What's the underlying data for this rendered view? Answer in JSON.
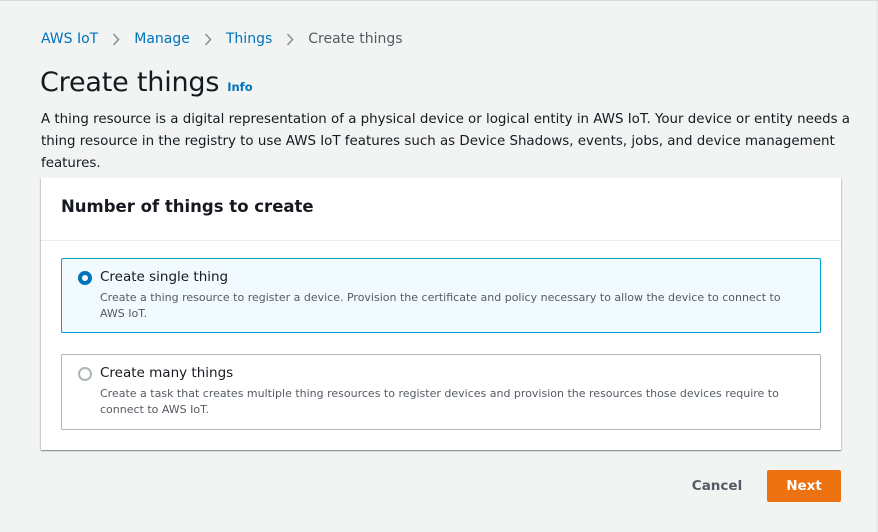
{
  "breadcrumb": {
    "items": [
      {
        "label": "AWS IoT"
      },
      {
        "label": "Manage"
      },
      {
        "label": "Things"
      },
      {
        "label": "Create things"
      }
    ]
  },
  "page": {
    "title": "Create things",
    "info_label": "Info",
    "description": "A thing resource is a digital representation of a physical device or logical entity in AWS IoT. Your device or entity needs a thing resource in the registry to use AWS IoT features such as Device Shadows, events, jobs, and device management features."
  },
  "panel": {
    "title": "Number of things to create",
    "options": [
      {
        "label": "Create single thing",
        "description": "Create a thing resource to register a device. Provision the certificate and policy necessary to allow the device to connect to AWS IoT.",
        "selected": true
      },
      {
        "label": "Create many things",
        "description": "Create a task that creates multiple thing resources to register devices and provision the resources those devices require to connect to AWS IoT.",
        "selected": false
      }
    ]
  },
  "actions": {
    "cancel_label": "Cancel",
    "next_label": "Next"
  },
  "colors": {
    "accent": "#ec7211",
    "link": "#0073bb",
    "selected_border": "#00a1c9",
    "selected_bg": "#f1faff"
  }
}
